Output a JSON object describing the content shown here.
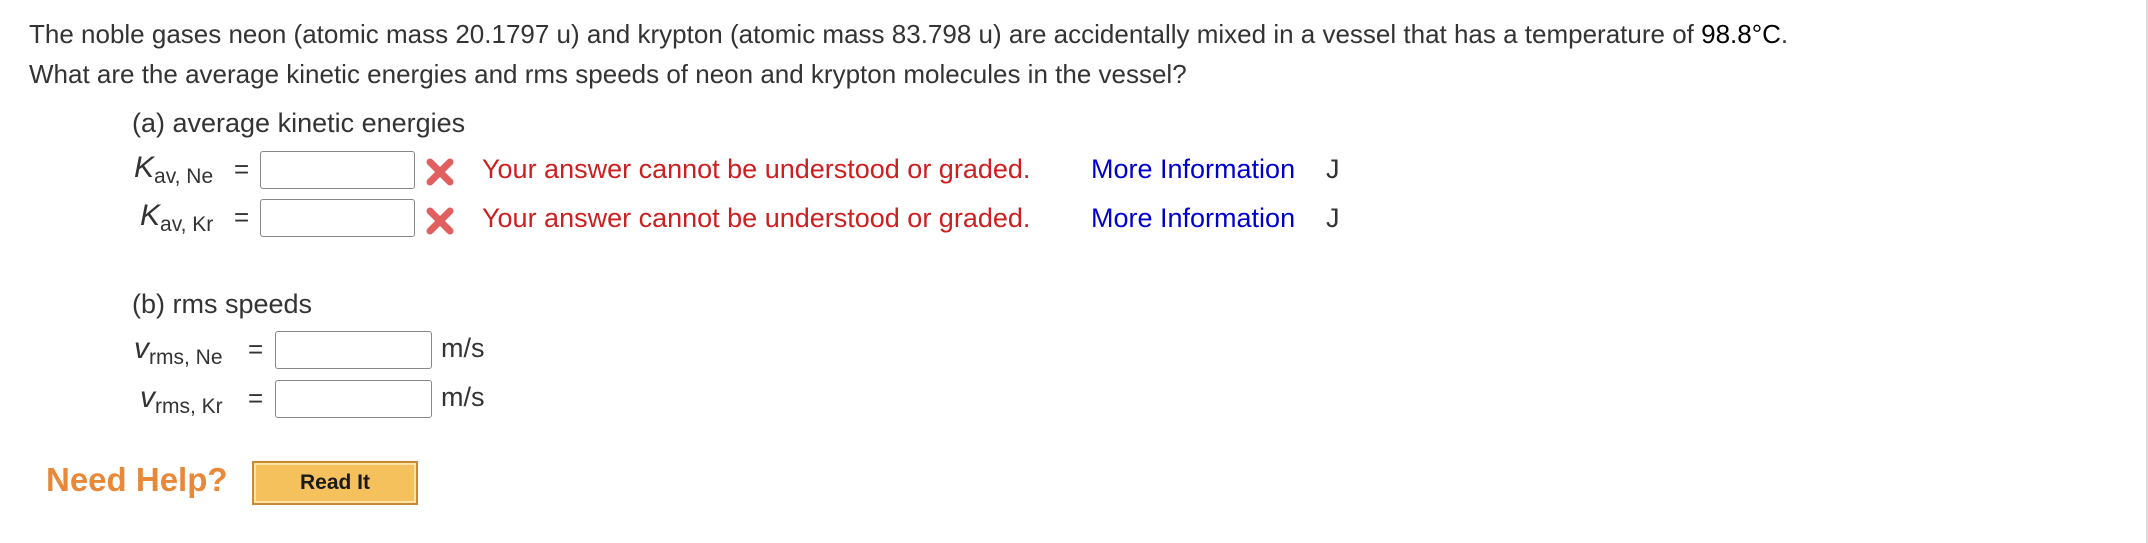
{
  "question": {
    "line1_before": "The noble gases neon (atomic mass 20.1797 u) and krypton (atomic mass 83.798 u) are accidentally mixed in a vessel that has a temperature of ",
    "temperature": "98.8°C",
    "line1_after": ".",
    "line2": "What are the average kinetic energies and rms speeds of neon and krypton molecules in the vessel?"
  },
  "part_a": {
    "title": "(a) average kinetic energies",
    "rows": [
      {
        "var": "K",
        "sub": "av, Ne",
        "eq": "=",
        "value": "",
        "error": "Your answer cannot be understood or graded.",
        "link": "More Information",
        "unit": "J"
      },
      {
        "var": "K",
        "sub": "av, Kr",
        "eq": "=",
        "value": "",
        "error": "Your answer cannot be understood or graded.",
        "link": "More Information",
        "unit": "J"
      }
    ]
  },
  "part_b": {
    "title": "(b) rms speeds",
    "rows": [
      {
        "var": "v",
        "sub": "rms, Ne",
        "eq": "=",
        "value": "",
        "unit": "m/s"
      },
      {
        "var": "v",
        "sub": "rms, Kr",
        "eq": "=",
        "value": "",
        "unit": "m/s"
      }
    ]
  },
  "help": {
    "label": "Need Help?",
    "button": "Read It"
  },
  "colors": {
    "error": "#cc1f1f",
    "link": "#0000cc",
    "help": "#e8893a",
    "button": "#f4c15c"
  }
}
